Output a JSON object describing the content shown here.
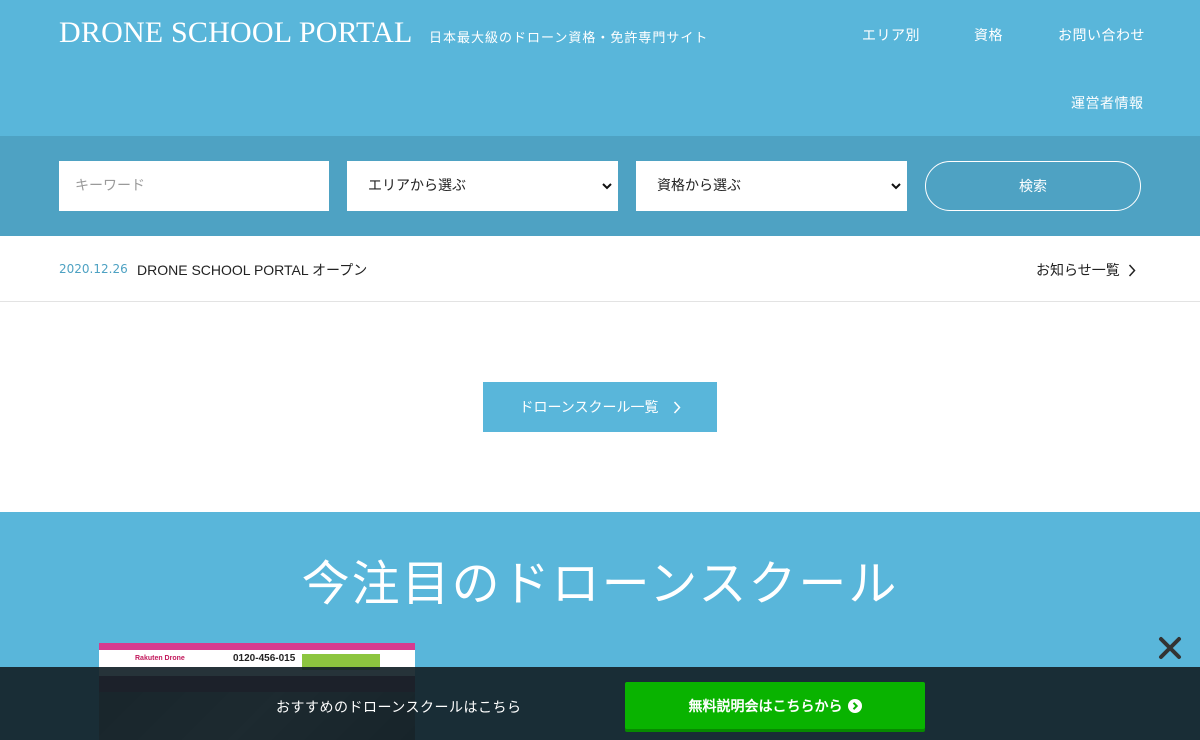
{
  "header": {
    "logo": "DRONE SCHOOL PORTAL",
    "tagline": "日本最大級のドローン資格・免許専門サイト",
    "nav": [
      "エリア別",
      "資格",
      "お問い合わせ",
      "運営者情報"
    ],
    "bg_color": "#59b6da"
  },
  "search": {
    "keyword_placeholder": "キーワード",
    "area_select": "エリアから選ぶ",
    "license_select": "資格から選ぶ",
    "button_label": "検索",
    "bg_color": "#4ea2c3"
  },
  "news": {
    "date": "2020.12.26",
    "title": "DRONE SCHOOL PORTAL オープン",
    "all_link": "お知らせ一覧",
    "icon": "chevron-right-icon"
  },
  "school_list_button": "ドローンスクール一覧",
  "featured": {
    "title": "今注目のドローンスクール"
  },
  "promo_thumbnail": {
    "brand": "Rakuten Drone",
    "phone": "0120-456-015"
  },
  "bottom_bar": {
    "text": "おすすめのドローンスクールはこちら",
    "cta_label": "無料説明会はこちらから",
    "cta_color": "#09b300",
    "cta_icon": "circle-chevron-right-icon",
    "close_icon": "close-icon"
  }
}
